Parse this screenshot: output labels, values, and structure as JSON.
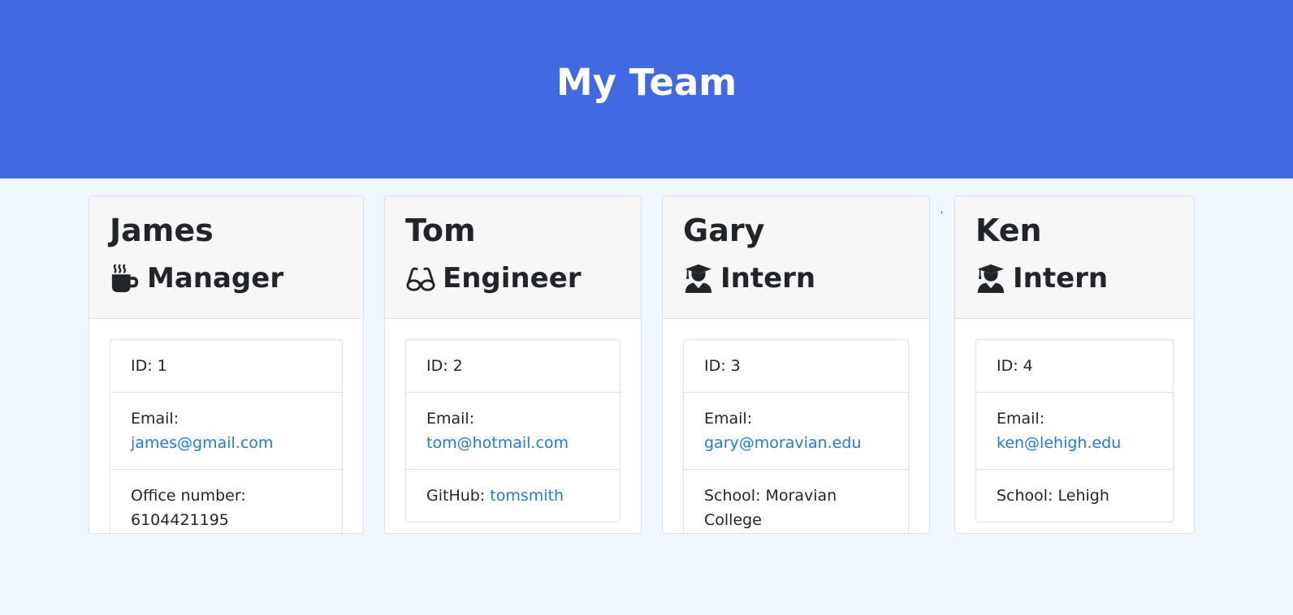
{
  "header": {
    "title": "My Team"
  },
  "stray_mark": "'",
  "team": [
    {
      "name": "James",
      "role": "Manager",
      "role_icon": "mug-icon",
      "id_label": "ID: 1",
      "email_label": "Email:",
      "email": "james@gmail.com",
      "extra_label": "Office number:",
      "extra_value": "6104421195"
    },
    {
      "name": "Tom",
      "role": "Engineer",
      "role_icon": "glasses-icon",
      "id_label": "ID: 2",
      "email_label": "Email:",
      "email": "tom@hotmail.com",
      "extra_label": "GitHub:",
      "extra_value": "tomsmith"
    },
    {
      "name": "Gary",
      "role": "Intern",
      "role_icon": "graduate-icon",
      "id_label": "ID: 3",
      "email_label": "Email:",
      "email": "gary@moravian.edu",
      "extra_label": "School:",
      "extra_value": "Moravian College"
    },
    {
      "name": "Ken",
      "role": "Intern",
      "role_icon": "graduate-icon",
      "id_label": "ID: 4",
      "email_label": "Email:",
      "email": "ken@lehigh.edu",
      "extra_label": "School:",
      "extra_value": "Lehigh"
    }
  ]
}
